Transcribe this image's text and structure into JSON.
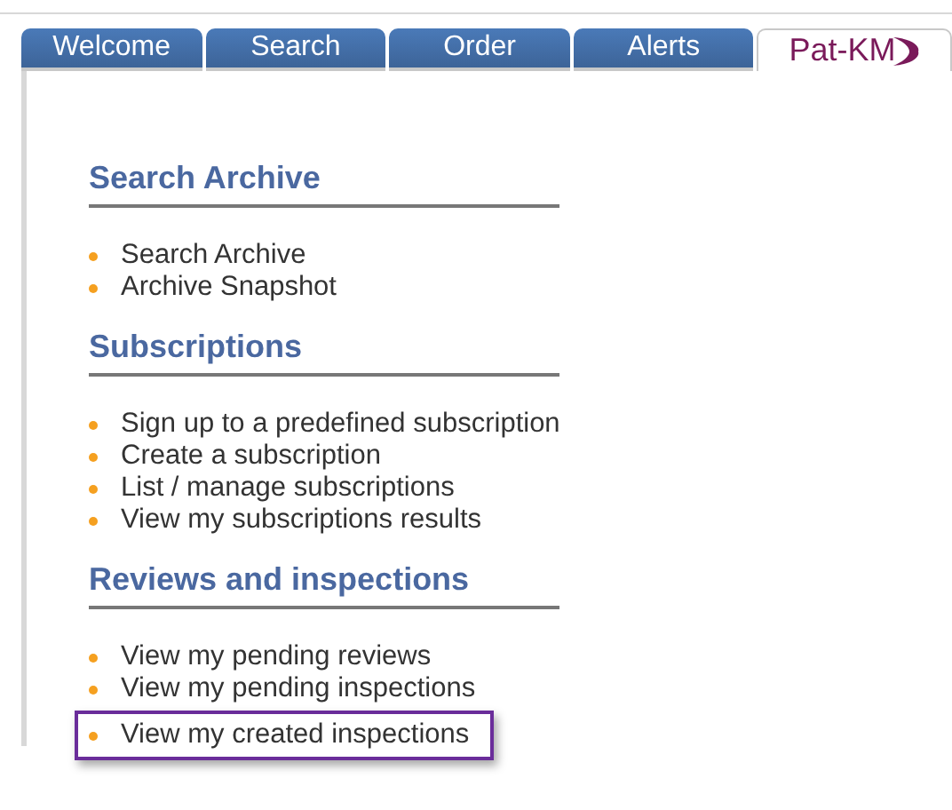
{
  "tabs": [
    {
      "label": "Welcome",
      "kind": "nav",
      "selected": false
    },
    {
      "label": "Search",
      "kind": "nav",
      "selected": false
    },
    {
      "label": "Order",
      "kind": "nav",
      "selected": false
    },
    {
      "label": "Alerts",
      "kind": "nav",
      "selected": false
    },
    {
      "label": "Pat-KM",
      "kind": "logo",
      "selected": true
    }
  ],
  "sections": [
    {
      "title": "Search Archive",
      "items": [
        {
          "label": "Search Archive",
          "highlighted": false
        },
        {
          "label": "Archive Snapshot",
          "highlighted": false
        }
      ]
    },
    {
      "title": "Subscriptions",
      "items": [
        {
          "label": "Sign up to a predefined subscription",
          "highlighted": false
        },
        {
          "label": "Create a subscription",
          "highlighted": false
        },
        {
          "label": "List / manage subscriptions",
          "highlighted": false
        },
        {
          "label": "View my subscriptions results",
          "highlighted": false
        }
      ]
    },
    {
      "title": "Reviews and inspections",
      "items": [
        {
          "label": "View my pending reviews",
          "highlighted": false
        },
        {
          "label": "View my pending inspections",
          "highlighted": false
        },
        {
          "label": "View my created inspections",
          "highlighted": true
        }
      ]
    }
  ]
}
